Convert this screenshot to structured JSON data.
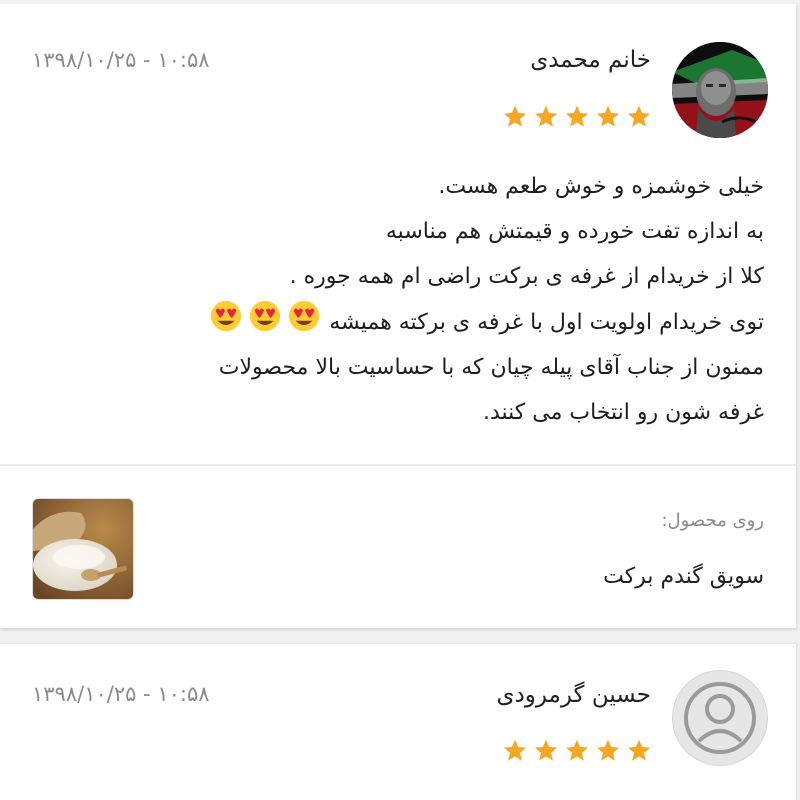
{
  "reviews": [
    {
      "author": "خانم محمدی",
      "datetime": "۱۳۹۸/۱۰/۲۵ - ۱۰:۵۸",
      "rating": 5,
      "comment_lines": [
        "خیلی خوشمزه و خوش طعم هست.",
        "به اندازه تفت خورده و قیمتش هم مناسبه",
        "کلا از خریدام از غرفه ی برکت راضی ام همه جوره .",
        "توی خریدام اولویت اول با غرفه ی برکته همیشه",
        "ممنون از جناب آقای پیله چیان که با حساسیت بالا محصولات",
        "غرفه شون رو انتخاب می کنند."
      ],
      "emojis": [
        "heart-eyes-emoji",
        "heart-eyes-emoji",
        "heart-eyes-emoji"
      ],
      "product": {
        "label": "روی محصول:",
        "name": "سویق گندم برکت"
      }
    },
    {
      "author": "حسین گرمرودی",
      "datetime": "۱۳۹۸/۱۰/۲۵ - ۱۰:۵۸",
      "rating": 5
    }
  ],
  "colors": {
    "star": "#f5a623",
    "background": "#f1f1f1",
    "card": "#ffffff",
    "meta_text": "#8a8a8a"
  },
  "icons": {
    "star": "star-icon",
    "default_avatar": "user-avatar-icon"
  }
}
